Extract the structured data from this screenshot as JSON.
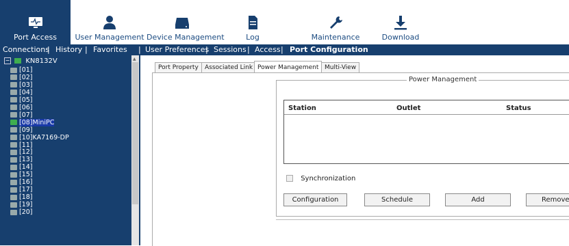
{
  "topnav": [
    {
      "label": "Port Access",
      "icon": "monitor-icon",
      "active": true
    },
    {
      "label": "User Management",
      "icon": "user-icon",
      "active": false
    },
    {
      "label": "Device Management",
      "icon": "device-icon",
      "active": false
    },
    {
      "label": "Log",
      "icon": "document-icon",
      "active": false
    },
    {
      "label": "Maintenance",
      "icon": "wrench-icon",
      "active": false
    },
    {
      "label": "Download",
      "icon": "download-icon",
      "active": false
    }
  ],
  "subnav": {
    "connections": "Connections",
    "history": "History",
    "favorites": "Favorites",
    "user_preferences": "User Preferences",
    "sessions": "Sessions",
    "access": "Access",
    "port_configuration": "Port Configuration",
    "sep": "|"
  },
  "tree": {
    "root": "KN8132V",
    "expand_symbol": "−",
    "ports": [
      "[01]",
      "[02]",
      "[03]",
      "[04]",
      "[05]",
      "[06]",
      "[07]",
      "[08]MiniPC",
      "[09]",
      "[10]KA7169-DP",
      "[11]",
      "[12]",
      "[13]",
      "[14]",
      "[15]",
      "[16]",
      "[17]",
      "[18]",
      "[19]",
      "[20]"
    ],
    "selected": "[08]MiniPC"
  },
  "tabs": [
    "Port Property",
    "Associated Link",
    "Power Management",
    "Multi-View"
  ],
  "active_tab": "Power Management",
  "power": {
    "legend": "Power Management",
    "columns": {
      "station": "Station",
      "outlet": "Outlet",
      "status": "Status"
    },
    "sync_label": "Synchronization",
    "buttons": {
      "configuration": "Configuration",
      "schedule": "Schedule",
      "add": "Add",
      "remove": "Remove"
    }
  },
  "colors": {
    "brand": "#173f6e",
    "selected": "#1a3aa8",
    "online": "#3fae4f"
  }
}
